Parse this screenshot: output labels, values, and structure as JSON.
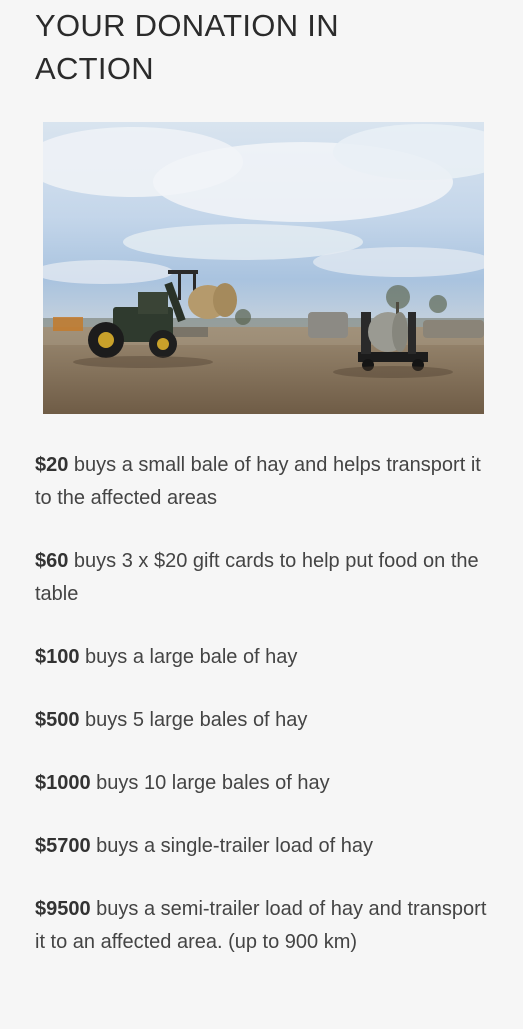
{
  "heading": "YOUR DONATION IN ACTION",
  "image": {
    "icon": "tractor-hay-bales-photo"
  },
  "items": [
    {
      "amount": "$20",
      "text": " buys a small bale of hay and helps transport it to the affected areas"
    },
    {
      "amount": "$60",
      "text": " buys 3 x $20 gift cards to help put food on the table"
    },
    {
      "amount": "$100",
      "text": " buys a large bale of hay"
    },
    {
      "amount": "$500",
      "text": " buys 5 large bales of hay"
    },
    {
      "amount": "$1000",
      "text": " buys 10 large bales of hay"
    },
    {
      "amount": "$5700",
      "text": " buys a single-trailer load of hay"
    },
    {
      "amount": "$9500",
      "text": " buys a semi-trailer load of hay and transport it to an affected area. (up to 900 km)"
    }
  ]
}
